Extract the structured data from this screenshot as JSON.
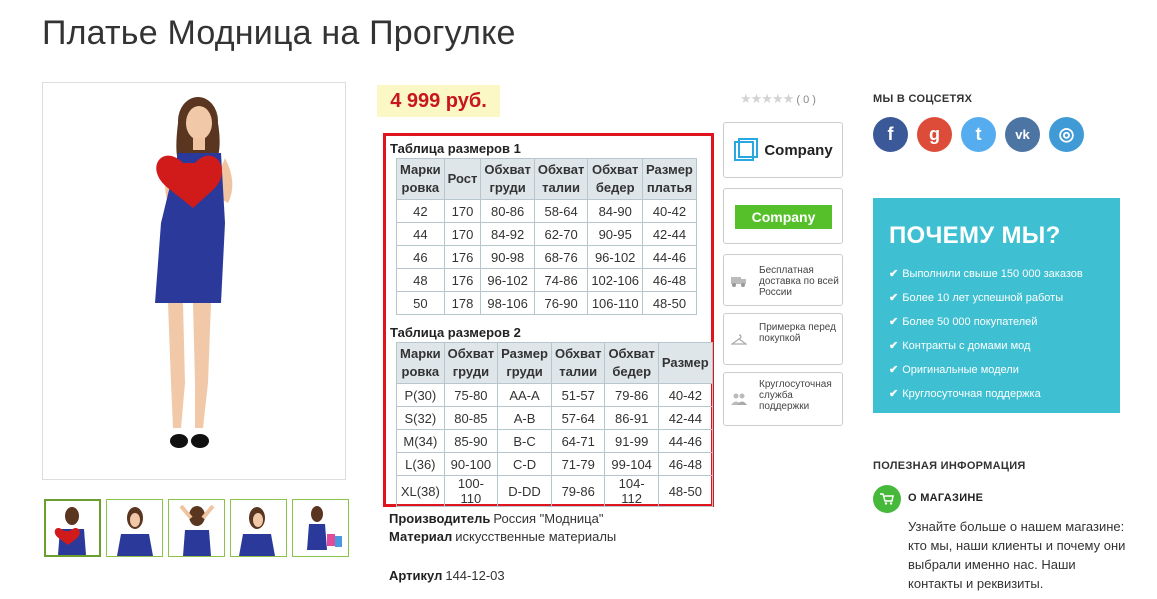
{
  "title": "Платье Модница на Прогулке",
  "price": "4 999 руб.",
  "table1": {
    "title": "Таблица размеров 1",
    "headers": [
      [
        "Марки",
        "ровка"
      ],
      [
        "Рост",
        ""
      ],
      [
        "Обхват",
        "груди"
      ],
      [
        "Обхват",
        "талии"
      ],
      [
        "Обхват",
        "бедер"
      ],
      [
        "Размер",
        "платья"
      ]
    ],
    "rows": [
      [
        "42",
        "170",
        "80-86",
        "58-64",
        "84-90",
        "40-42"
      ],
      [
        "44",
        "170",
        "84-92",
        "62-70",
        "90-95",
        "42-44"
      ],
      [
        "46",
        "176",
        "90-98",
        "68-76",
        "96-102",
        "44-46"
      ],
      [
        "48",
        "176",
        "96-102",
        "74-86",
        "102-106",
        "46-48"
      ],
      [
        "50",
        "178",
        "98-106",
        "76-90",
        "106-110",
        "48-50"
      ]
    ]
  },
  "table2": {
    "title": "Таблица размеров 2",
    "headers": [
      [
        "Марки",
        "ровка"
      ],
      [
        "Обхват",
        "груди"
      ],
      [
        "Размер",
        "груди"
      ],
      [
        "Обхват",
        "талии"
      ],
      [
        "Обхват",
        "бедер"
      ],
      [
        "Размер",
        ""
      ]
    ],
    "rows": [
      [
        "P(30)",
        "75-80",
        "AA-A",
        "51-57",
        "79-86",
        "40-42"
      ],
      [
        "S(32)",
        "80-85",
        "A-B",
        "57-64",
        "86-91",
        "42-44"
      ],
      [
        "M(34)",
        "85-90",
        "B-C",
        "64-71",
        "91-99",
        "44-46"
      ],
      [
        "L(36)",
        "90-100",
        "C-D",
        "71-79",
        "99-104",
        "46-48"
      ],
      [
        "XL(38)",
        "100-110",
        "D-DD",
        "79-86",
        "104-112",
        "48-50"
      ]
    ]
  },
  "specs": {
    "manufacturer_label": "Производитель",
    "manufacturer_value": "Россия \"Модница\"",
    "material_label": "Материал",
    "material_value": "искусственные материалы",
    "article_label": "Артикул",
    "article_value": "144-12-03"
  },
  "rating": {
    "stars": "★★★★★",
    "count": "( 0 )"
  },
  "logos": {
    "logo1": "Company",
    "logo2": "Company"
  },
  "features": [
    "Бесплатная доставка по всей России",
    "Примерка перед покупкой",
    "Круглосуточная служба поддержки"
  ],
  "social": {
    "title": "МЫ В СОЦСЕТЯХ",
    "fb": "f",
    "gp": "g",
    "tw": "t",
    "vk": "vk",
    "ig": "◎"
  },
  "why": {
    "title": "ПОЧЕМУ МЫ?",
    "items": [
      "Выполнили свыше 150 000 заказов",
      "Более 10 лет успешной работы",
      "Более 50 000 покупателей",
      "Контракты с домами мод",
      "Оригинальные модели",
      "Круглосуточная поддержка"
    ]
  },
  "info": {
    "title": "ПОЛЕЗНАЯ ИНФОРМАЦИЯ",
    "about_title": "О МАГАЗИНЕ",
    "about_text": "Узнайте больше о нашем магазине: кто мы, наши клиенты и почему они выбрали именно нас. Наши контакты и реквизиты."
  },
  "colors": {
    "price": "#c8161d",
    "accent": "#3ec0d2",
    "highlight": "#e0141c"
  }
}
